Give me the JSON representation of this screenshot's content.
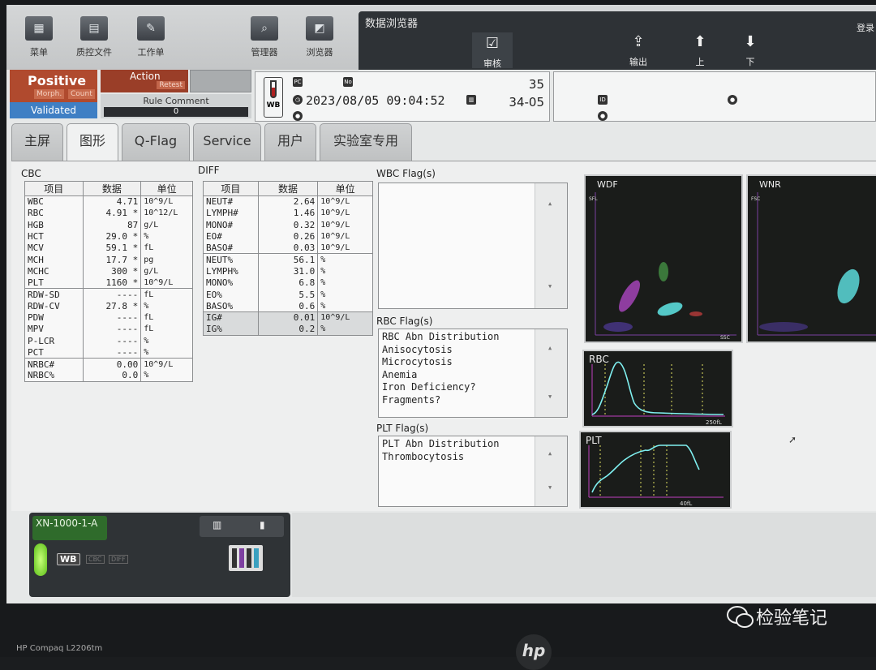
{
  "toolbar": {
    "items": [
      {
        "label": "菜单",
        "icon": "menu-grid-icon"
      },
      {
        "label": "质控文件",
        "icon": "qc-file-icon"
      },
      {
        "label": "工作单",
        "icon": "worklist-icon"
      },
      {
        "label": "管理器",
        "icon": "manager-icon"
      },
      {
        "label": "浏览器",
        "icon": "browser-icon"
      }
    ],
    "browser_title": "数据浏览器",
    "login": "登录",
    "review": "审核",
    "export": "输出",
    "up": "上",
    "down": "下"
  },
  "status": {
    "positive": "Positive",
    "morph": "Morph.",
    "count": "Count",
    "validated": "Validated",
    "action": "Action",
    "retest": "Retest",
    "rule_comment_label": "Rule Comment",
    "rule_comment_value": "0"
  },
  "sample": {
    "mode": "WB",
    "datetime": "2023/08/05 09:04:52",
    "sample_no": "35",
    "rack_position": "34-05",
    "pc_icon_text": "PC",
    "no_icon_text": "No",
    "id_icon_text": "ID"
  },
  "tabs": [
    "主屏",
    "图形",
    "Q-Flag",
    "Service",
    "用户",
    "实验室专用"
  ],
  "active_tab": "图形",
  "cbc": {
    "title": "CBC",
    "headers": [
      "项目",
      "数据",
      "单位"
    ],
    "rows": [
      {
        "item": "WBC",
        "value": "4.71",
        "flag": "",
        "unit": "10^9/L"
      },
      {
        "item": "RBC",
        "value": "4.91",
        "flag": "*",
        "unit": "10^12/L"
      },
      {
        "item": "HGB",
        "value": "87",
        "flag": "",
        "unit": "g/L"
      },
      {
        "item": "HCT",
        "value": "29.0",
        "flag": "*",
        "unit": "%"
      },
      {
        "item": "MCV",
        "value": "59.1",
        "flag": "*",
        "unit": "fL"
      },
      {
        "item": "MCH",
        "value": "17.7",
        "flag": "*",
        "unit": "pg"
      },
      {
        "item": "MCHC",
        "value": "300",
        "flag": "*",
        "unit": "g/L"
      },
      {
        "item": "PLT",
        "value": "1160",
        "flag": "*",
        "unit": "10^9/L"
      },
      {
        "item": "RDW-SD",
        "value": "----",
        "flag": "",
        "unit": "fL"
      },
      {
        "item": "RDW-CV",
        "value": "27.8",
        "flag": "*",
        "unit": "%"
      },
      {
        "item": "PDW",
        "value": "----",
        "flag": "",
        "unit": "fL"
      },
      {
        "item": "MPV",
        "value": "----",
        "flag": "",
        "unit": "fL"
      },
      {
        "item": "P-LCR",
        "value": "----",
        "flag": "",
        "unit": "%"
      },
      {
        "item": "PCT",
        "value": "----",
        "flag": "",
        "unit": "%"
      },
      {
        "item": "NRBC#",
        "value": "0.00",
        "flag": "",
        "unit": "10^9/L"
      },
      {
        "item": "NRBC%",
        "value": "0.0",
        "flag": "",
        "unit": "%"
      }
    ]
  },
  "diff": {
    "title": "DIFF",
    "headers": [
      "项目",
      "数据",
      "单位"
    ],
    "rows": [
      {
        "item": "NEUT#",
        "value": "2.64",
        "unit": "10^9/L"
      },
      {
        "item": "LYMPH#",
        "value": "1.46",
        "unit": "10^9/L"
      },
      {
        "item": "MONO#",
        "value": "0.32",
        "unit": "10^9/L"
      },
      {
        "item": "EO#",
        "value": "0.26",
        "unit": "10^9/L"
      },
      {
        "item": "BASO#",
        "value": "0.03",
        "unit": "10^9/L"
      },
      {
        "item": "NEUT%",
        "value": "56.1",
        "unit": "%"
      },
      {
        "item": "LYMPH%",
        "value": "31.0",
        "unit": "%"
      },
      {
        "item": "MONO%",
        "value": "6.8",
        "unit": "%"
      },
      {
        "item": "EO%",
        "value": "5.5",
        "unit": "%"
      },
      {
        "item": "BASO%",
        "value": "0.6",
        "unit": "%"
      },
      {
        "item": "IG#",
        "value": "0.01",
        "unit": "10^9/L"
      },
      {
        "item": "IG%",
        "value": "0.2",
        "unit": "%"
      }
    ]
  },
  "flags": {
    "wbc_title": "WBC Flag(s)",
    "wbc_items": [],
    "rbc_title": "RBC Flag(s)",
    "rbc_items": [
      "RBC Abn Distribution",
      "Anisocytosis",
      "Microcytosis",
      "Anemia",
      "Iron Deficiency?",
      "Fragments?"
    ],
    "plt_title": "PLT Flag(s)",
    "plt_items": [
      "PLT Abn Distribution",
      "Thrombocytosis"
    ]
  },
  "graphs": {
    "wdf": {
      "label": "WDF",
      "x_axis": "SSC",
      "y_axis": "SFL"
    },
    "wnr": {
      "label": "WNR",
      "y_axis": "FSC"
    },
    "rbc": {
      "label": "RBC",
      "x_max_label": "250fL"
    },
    "plt": {
      "label": "PLT",
      "x_max_label": "40fL"
    }
  },
  "analyzer": {
    "name": "XN-1000-1-A",
    "mode_wb": "WB",
    "mode_cbc": "CBC",
    "mode_diff": "DIFF"
  },
  "watermark": "检验笔记",
  "monitor_brand": "HP Compaq L2206tm"
}
